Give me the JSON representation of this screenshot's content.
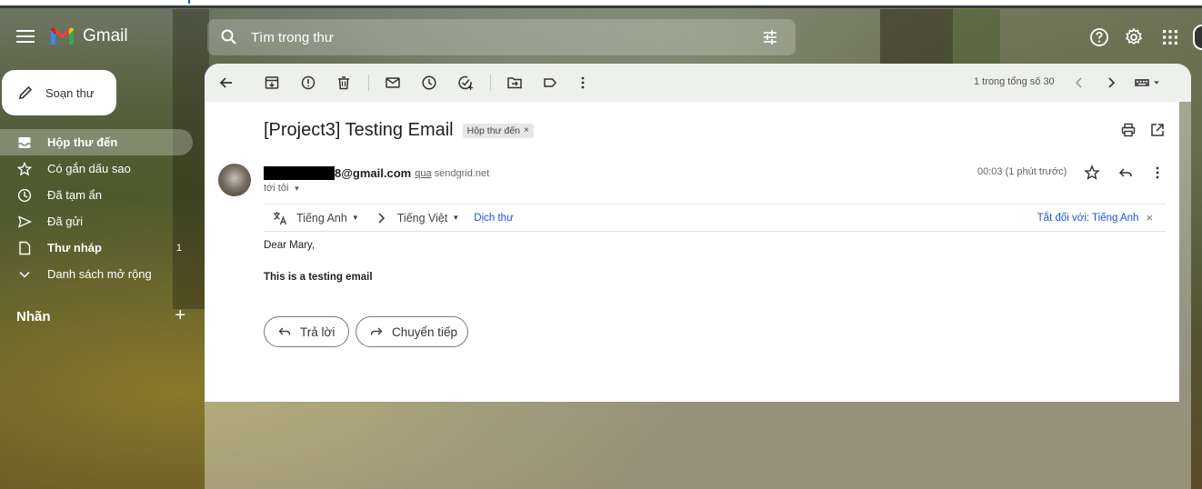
{
  "app": {
    "name": "Gmail"
  },
  "search": {
    "placeholder": "Tìm trong thư"
  },
  "compose": {
    "label": "Soạn thư"
  },
  "sidebar": {
    "items": [
      {
        "label": "Hộp thư đến",
        "icon": "inbox-icon",
        "count": ""
      },
      {
        "label": "Có gắn dấu sao",
        "icon": "star-icon",
        "count": ""
      },
      {
        "label": "Đã tạm ẩn",
        "icon": "clock-icon",
        "count": ""
      },
      {
        "label": "Đã gửi",
        "icon": "send-icon",
        "count": ""
      },
      {
        "label": "Thư nháp",
        "icon": "draft-icon",
        "count": "1"
      },
      {
        "label": "Danh sách mở rộng",
        "icon": "chevron-down-icon",
        "count": ""
      }
    ],
    "labels_title": "Nhãn",
    "labels_add": "+"
  },
  "toolbar": {
    "pager": "1 trong tổng số 30"
  },
  "email": {
    "subject": "[Project3] Testing Email",
    "folder_chip": "Hộp thư đến",
    "sender_address": "8@gmail.com",
    "via_word": "qua",
    "via_domain": "sendgrid.net",
    "to": "tới tôi",
    "time": "00:03 (1 phút trước)",
    "greeting": "Dear Mary,",
    "body": "This is a testing email"
  },
  "translate": {
    "from_lang": "Tiếng Anh",
    "to_lang": "Tiếng Việt",
    "translate_link": "Dịch thư",
    "turn_off": "Tắt đối với: Tiếng Anh"
  },
  "actions": {
    "reply": "Trả lời",
    "forward": "Chuyển tiếp"
  },
  "colors": {
    "link": "#1a55d8",
    "gmail_red": "#ea4335",
    "gmail_blue": "#4285f4",
    "gmail_green": "#34a853",
    "gmail_yellow": "#fbbc04"
  }
}
